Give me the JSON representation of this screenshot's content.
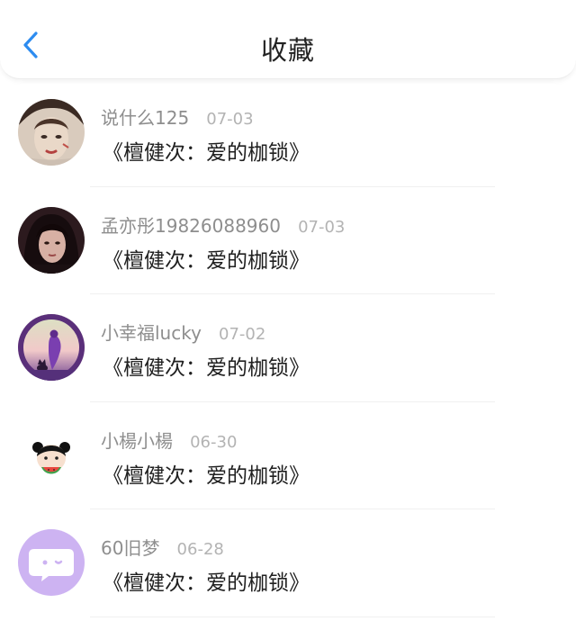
{
  "header": {
    "title": "收藏",
    "back_icon": "chevron-left-icon",
    "accent_color": "#2d8cf0"
  },
  "items": [
    {
      "username": "说什么125",
      "date": "07-03",
      "title": "《檀健次：爱的枷锁》",
      "avatar": "avatar-photo-man"
    },
    {
      "username": "孟亦彤19826088960",
      "date": "07-03",
      "title": "《檀健次：爱的枷锁》",
      "avatar": "avatar-photo-woman"
    },
    {
      "username": "小幸福lucky",
      "date": "07-02",
      "title": "《檀健次：爱的枷锁》",
      "avatar": "avatar-purple-illustration"
    },
    {
      "username": "小楊小楊",
      "date": "06-30",
      "title": "《檀健次：爱的枷锁》",
      "avatar": "avatar-cartoon-girl"
    },
    {
      "username": "60旧梦",
      "date": "06-28",
      "title": "《檀健次：爱的枷锁》",
      "avatar": "avatar-chat-bubble"
    }
  ]
}
